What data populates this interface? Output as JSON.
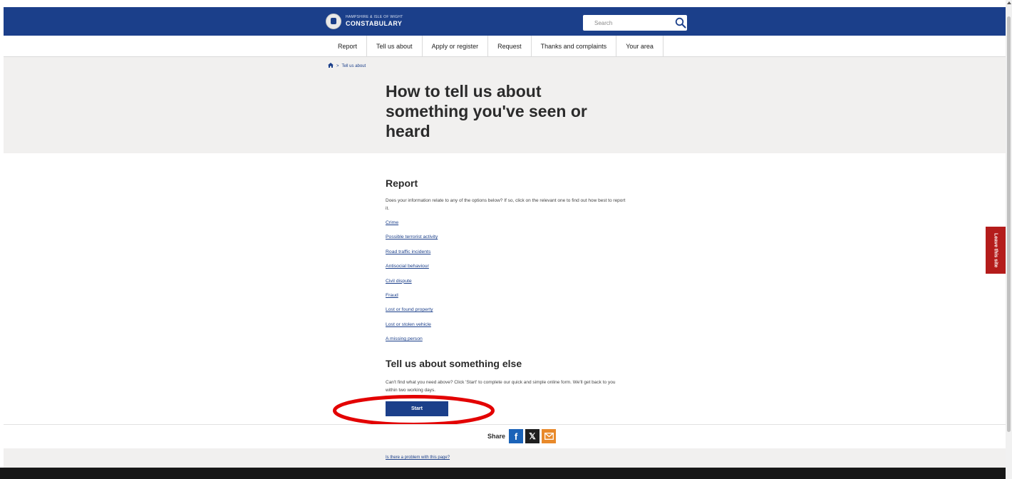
{
  "header": {
    "logo_small": "HAMPSHIRE & ISLE OF WIGHT",
    "logo_big": "CONSTABULARY",
    "search_placeholder": "Search",
    "search_icon": "search-icon",
    "background": "#1b3f8a"
  },
  "nav": {
    "items": [
      "Report",
      "Tell us about",
      "Apply or register",
      "Request",
      "Thanks and complaints",
      "Your area"
    ]
  },
  "breadcrumb": {
    "home_icon": "home-icon",
    "separator": ">",
    "current": "Tell us about"
  },
  "page": {
    "title": "How to tell us about something you've seen or heard"
  },
  "report": {
    "heading": "Report",
    "intro": "Does your information relate to any of the options below? If so, click on the relevant one to find out how best to report it.",
    "links": [
      "Crime",
      "Possible terrorist activity",
      "Road traffic incidents",
      "Antisocial behaviour",
      "Civil dispute",
      "Fraud",
      "Lost or found property",
      "Lost or stolen vehicle",
      "A missing person"
    ]
  },
  "other": {
    "heading": "Tell us about something else",
    "intro": "Can't find what you need above? Click 'Start' to complete our quick and simple online form. We'll get back to you within two working days.",
    "start_label": "Start"
  },
  "share": {
    "label": "Share",
    "facebook": "f",
    "x": "𝕏",
    "icons": [
      "facebook-icon",
      "x-icon",
      "email-icon"
    ]
  },
  "problem_link": "Is there a problem with this page?",
  "leave_site": "Leave this site",
  "colors": {
    "brand": "#1b3f8a",
    "leave": "#b41c1b",
    "annotation": "#e30000"
  }
}
